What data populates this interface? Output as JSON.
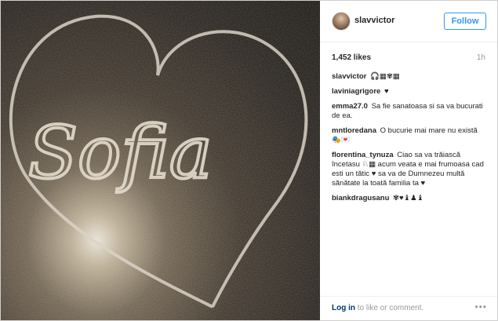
{
  "header": {
    "username": "slavvictor",
    "follow_label": "Follow"
  },
  "post": {
    "likes": "1,452 likes",
    "time": "1h",
    "photo_text": "Sofia"
  },
  "comments": [
    {
      "user": "slavvictor",
      "text": "🎧▦✾▦"
    },
    {
      "user": "laviniagrigore",
      "text": "♥"
    },
    {
      "user": "emma27.0",
      "text": "Sa fie sanatoasa si sa va bucurati de ea."
    },
    {
      "user": "mntloredana",
      "text": "O bucurie mai mare nu există 🎭💌"
    },
    {
      "user": "florentina_tynuza",
      "text": "Ciao sa va trăiască încetasu ♘▦ acum veata e mai frumoasa cad esti un tătic ♥ sa va de Dumnezeu multă sănătate la toată familia ta ♥"
    },
    {
      "user": "biankdragusanu",
      "text": "✾♥♝♟♝"
    }
  ],
  "footer": {
    "login_link": "Log in",
    "login_rest": " to like or comment.",
    "more_icon": "•••"
  },
  "colors": {
    "follow_blue": "#3897f0",
    "link_navy": "#003569"
  }
}
